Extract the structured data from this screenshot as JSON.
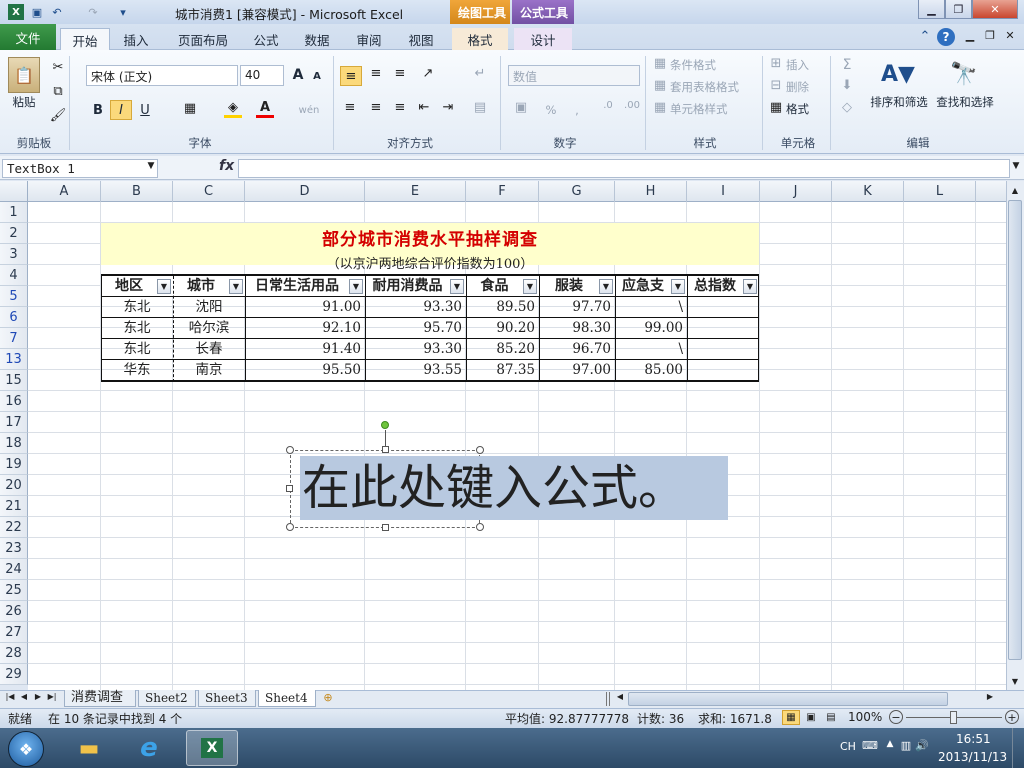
{
  "window": {
    "title": "城市消费1  [兼容模式] - Microsoft Excel",
    "ctx_drawing": "绘图工具",
    "ctx_formula": "公式工具"
  },
  "tabs": [
    "开始",
    "插入",
    "页面布局",
    "公式",
    "数据",
    "审阅",
    "视图",
    "格式",
    "设计"
  ],
  "file_tab": "文件",
  "ribbon": {
    "clipboard": {
      "paste": "粘贴",
      "label": "剪贴板"
    },
    "font": {
      "name": "宋体 (正文)",
      "size": "40",
      "bold": "B",
      "italic": "I",
      "underline": "U",
      "grow": "A",
      "shrink": "A",
      "label": "字体",
      "wen": "wén"
    },
    "align": {
      "label": "对齐方式"
    },
    "number": {
      "format": "数值",
      "label": "数字",
      "percent": "%",
      "comma": ","
    },
    "styles": {
      "cond": "条件格式",
      "table": "套用表格格式",
      "cell": "单元格样式",
      "label": "样式"
    },
    "cells": {
      "insert": "插入",
      "delete": "删除",
      "format": "格式",
      "label": "单元格"
    },
    "editing": {
      "sort": "排序和筛选",
      "find": "查找和选择",
      "label": "编辑",
      "sigma": "Σ"
    }
  },
  "formula_bar": {
    "name_box": "TextBox 1",
    "fx": "fx",
    "value": ""
  },
  "columns": [
    "A",
    "B",
    "C",
    "D",
    "E",
    "F",
    "G",
    "H",
    "I",
    "J",
    "K",
    "L"
  ],
  "rows": [
    "1",
    "2",
    "3",
    "4",
    "5",
    "6",
    "7",
    "13",
    "15",
    "16",
    "17",
    "18",
    "19",
    "20",
    "21",
    "22",
    "23",
    "24",
    "25",
    "26",
    "27",
    "28",
    "29"
  ],
  "sheet": {
    "title": "部分城市消费水平抽样调查",
    "subtitle": "（以京沪两地综合评价指数为100）",
    "headers": [
      "地区",
      "城市",
      "日常生活用品",
      "耐用消费品",
      "食品",
      "服装",
      "应急支",
      "总指数"
    ],
    "data": [
      [
        "东北",
        "沈阳",
        "91.00",
        "93.30",
        "89.50",
        "97.70",
        "\\",
        ""
      ],
      [
        "东北",
        "哈尔滨",
        "92.10",
        "95.70",
        "90.20",
        "98.30",
        "99.00",
        ""
      ],
      [
        "东北",
        "长春",
        "91.40",
        "93.30",
        "85.20",
        "96.70",
        "\\",
        ""
      ],
      [
        "华东",
        "南京",
        "95.50",
        "93.55",
        "87.35",
        "97.00",
        "85.00",
        ""
      ]
    ]
  },
  "textbox": {
    "text": "在此处键入公式。"
  },
  "sheet_tabs": [
    "消费调查",
    "Sheet2",
    "Sheet3",
    "Sheet4"
  ],
  "status": {
    "ready": "就绪",
    "found": "在 10 条记录中找到 4 个",
    "average": "平均值: 92.87777778",
    "count": "计数: 36",
    "sum": "求和: 1671.8",
    "zoom": "100%"
  },
  "taskbar": {
    "lang": "CH",
    "time": "16:51",
    "date": "2013/11/13"
  },
  "colors": {
    "title_red": "#d40000",
    "file_green": "#2e8b3c",
    "ctx_drawing": "#d48a1e",
    "ctx_formula": "#7a55a8",
    "header_fill": "#ffffcc"
  }
}
